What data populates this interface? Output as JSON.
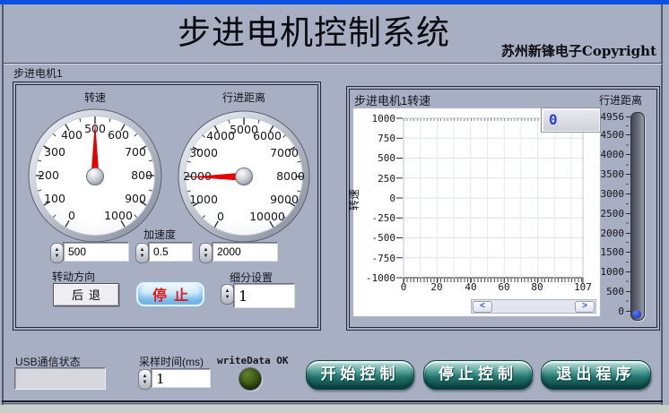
{
  "window": {
    "title": "步进电机控制系统",
    "copyright": "苏州新锋电子Copyright",
    "group_label": "步进电机1"
  },
  "icons": {
    "spin_up": "▲",
    "spin_down": "▼",
    "scroll_left": "<",
    "scroll_right": ">"
  },
  "speed_gauge": {
    "label": "转速",
    "ticks": [
      "0",
      "100",
      "200",
      "300",
      "400",
      "500",
      "600",
      "700",
      "800",
      "900",
      "1000"
    ],
    "value": "500"
  },
  "distance_gauge": {
    "label": "行进距离",
    "ticks": [
      "0",
      "1000",
      "2000",
      "3000",
      "4000",
      "5000",
      "6000",
      "7000",
      "8000",
      "9000",
      "10000"
    ],
    "value": "2000"
  },
  "controls": {
    "accel_label": "加速度",
    "accel_value": "0.5",
    "direction_label": "转动方向",
    "direction_button": "后退",
    "stop_button": "停止",
    "subdiv_label": "细分设置",
    "subdiv_value": "1"
  },
  "chart": {
    "title": "步进电机1转速",
    "ylabel": "转速",
    "digital_value": "0",
    "yticks": [
      "1000",
      "750",
      "500",
      "250",
      "0",
      "-250",
      "-500",
      "-750",
      "-1000"
    ],
    "xticks": [
      "0",
      "20",
      "40",
      "60",
      "80",
      "107"
    ]
  },
  "right_slider": {
    "label": "行进距离",
    "ticks": [
      "4956",
      "4500",
      "4000",
      "3500",
      "3000",
      "2500",
      "2000",
      "1500",
      "1000",
      "500",
      "0"
    ]
  },
  "status": {
    "usb_label": "USB通信状态",
    "usb_value": "",
    "sample_label": "采样时间(ms)",
    "sample_value": "1",
    "write_label": "writeData OK"
  },
  "footer_buttons": {
    "start": "开始控制",
    "stop": "停止控制",
    "exit": "退出程序"
  },
  "chart_data": [
    {
      "type": "line",
      "title": "步进电机1转速",
      "ylabel": "转速",
      "xlim": [
        0,
        107
      ],
      "ylim": [
        -1000,
        1000
      ],
      "xticks": [
        0,
        20,
        40,
        60,
        80,
        107
      ],
      "yticks": [
        1000,
        750,
        500,
        250,
        0,
        -250,
        -500,
        -750,
        -1000
      ],
      "grid": true,
      "series": [],
      "digital_display_value": 0,
      "right_axis": {
        "label": "行进距离",
        "min": 0,
        "max": 4956,
        "ticks": [
          4956,
          4500,
          4000,
          3500,
          3000,
          2500,
          2000,
          1500,
          1000,
          500,
          0
        ],
        "value": 0
      }
    },
    {
      "type": "gauge",
      "title": "转速",
      "min": 0,
      "max": 1000,
      "tick_step": 100,
      "value": 500
    },
    {
      "type": "gauge",
      "title": "行进距离",
      "min": 0,
      "max": 10000,
      "tick_step": 1000,
      "value": 2000
    }
  ]
}
